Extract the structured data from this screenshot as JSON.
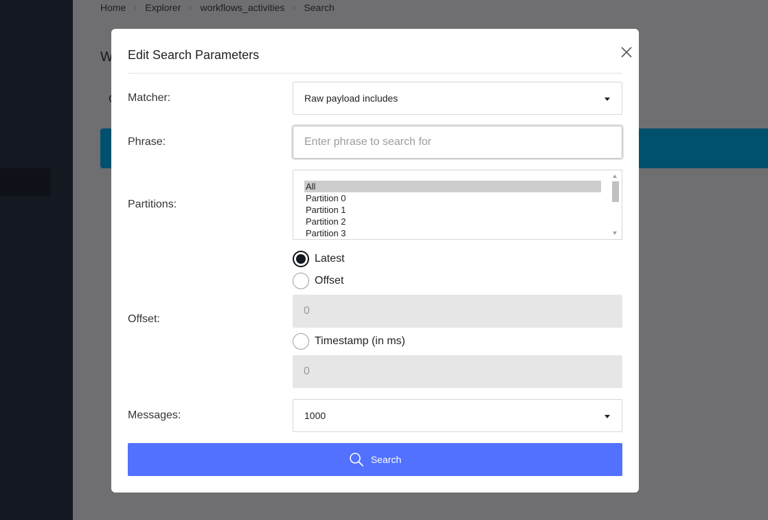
{
  "breadcrumb": [
    "Home",
    "Explorer",
    "workflows_activities",
    "Search"
  ],
  "background": {
    "title_partial": "W",
    "tab_partial": "C"
  },
  "modal": {
    "title": "Edit Search Parameters",
    "matcher": {
      "label": "Matcher:",
      "value": "Raw payload includes"
    },
    "phrase": {
      "label": "Phrase:",
      "placeholder": "Enter phrase to search for",
      "value": ""
    },
    "partitions": {
      "label": "Partitions:",
      "options": [
        "All",
        "Partition 0",
        "Partition 1",
        "Partition 2",
        "Partition 3"
      ],
      "selected": "All"
    },
    "offset": {
      "label": "Offset:",
      "options": {
        "latest": "Latest",
        "offset": "Offset",
        "timestamp": "Timestamp (in ms)"
      },
      "selected": "latest",
      "offset_value": "0",
      "timestamp_value": "0"
    },
    "messages": {
      "label": "Messages:",
      "value": "1000"
    },
    "search_button": "Search"
  },
  "colors": {
    "primary": "#5271ff",
    "banner": "#00506e",
    "sidebar": "#141821",
    "overlay": "#6f6f72"
  },
  "icons": {
    "close": "close-icon",
    "search": "search-icon",
    "caret": "chevron-down-icon"
  }
}
